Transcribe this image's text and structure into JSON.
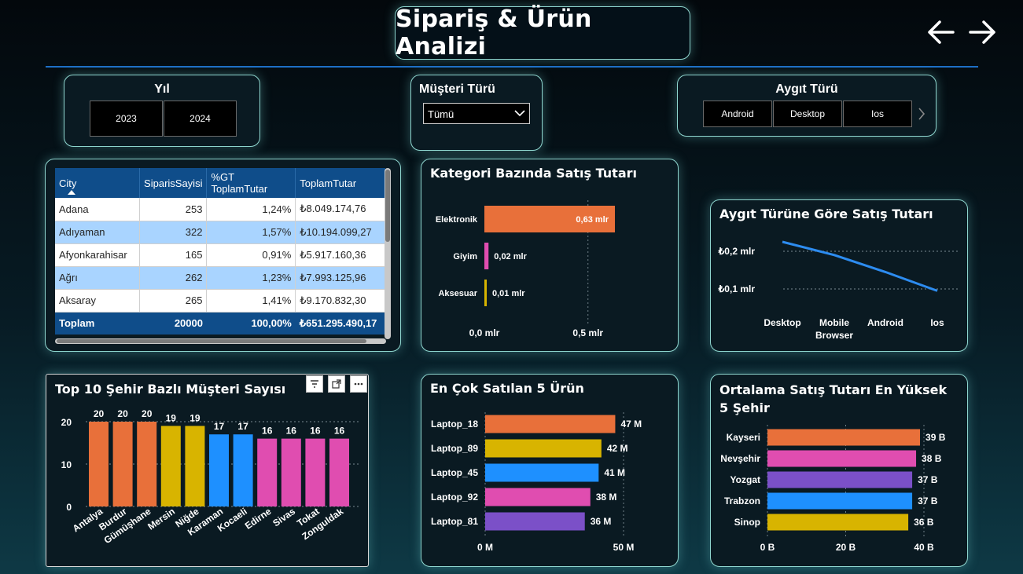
{
  "header": {
    "title": "Sipariş & Ürün Analizi",
    "back_icon": "arrow-left-icon",
    "forward_icon": "arrow-right-icon"
  },
  "slicer_year": {
    "title": "Yıl",
    "options": [
      "2023",
      "2024"
    ]
  },
  "slicer_customer": {
    "title": "Müşteri Türü",
    "selected": "Tümü"
  },
  "slicer_device": {
    "title": "Aygıt Türü",
    "options": [
      "Android",
      "Desktop",
      "Ios"
    ]
  },
  "city_table": {
    "headers": [
      "City",
      "SiparisSayisi",
      "%GT ToplamTutar",
      "ToplamTutar"
    ],
    "rows": [
      [
        "Adana",
        "253",
        "1,24%",
        "₺8.049.174,76"
      ],
      [
        "Adıyaman",
        "322",
        "1,57%",
        "₺10.194.099,27"
      ],
      [
        "Afyonkarahisar",
        "165",
        "0,91%",
        "₺5.917.160,36"
      ],
      [
        "Ağrı",
        "262",
        "1,23%",
        "₺7.993.125,96"
      ],
      [
        "Aksaray",
        "265",
        "1,41%",
        "₺9.170.832,30"
      ]
    ],
    "total": [
      "Toplam",
      "20000",
      "100,00%",
      "₺651.295.490,17"
    ]
  },
  "chart_data": [
    {
      "id": "category",
      "type": "bar",
      "orientation": "horizontal",
      "title": "Kategori Bazında Satış Tutarı",
      "categories": [
        "Elektronik",
        "Giyim",
        "Aksesuar"
      ],
      "values": [
        0.63,
        0.02,
        0.01
      ],
      "data_labels": [
        "0,63 mlr",
        "0,02 mlr",
        "0,01 mlr"
      ],
      "colors": [
        "#e8703a",
        "#e04db0",
        "#d8b400"
      ],
      "x_ticks": [
        "0,0 mlr",
        "0,5 mlr"
      ],
      "xlim": [
        0,
        0.63
      ]
    },
    {
      "id": "device",
      "type": "line",
      "title": "Aygıt Türüne Göre Satış Tutarı",
      "categories": [
        "Desktop",
        "Mobile Browser",
        "Android",
        "Ios"
      ],
      "values": [
        0.225,
        0.19,
        0.145,
        0.095
      ],
      "y_ticks": [
        "₺0,2 mlr",
        "₺0,1 mlr"
      ],
      "ylim": [
        0.1,
        0.2
      ],
      "color": "#2d8cf0"
    },
    {
      "id": "top10",
      "type": "bar",
      "title": "Top 10 Şehir Bazlı Müşteri Sayısı",
      "categories": [
        "Antalya",
        "Burdur",
        "Gümüşhane",
        "Mersin",
        "Niğde",
        "Karaman",
        "Kocaeli",
        "Edirne",
        "Sivas",
        "Tokat",
        "Zonguldak"
      ],
      "values": [
        20,
        20,
        20,
        19,
        19,
        17,
        17,
        16,
        16,
        16,
        16
      ],
      "colors": [
        "#e8703a",
        "#e8703a",
        "#e8703a",
        "#d8b400",
        "#d8b400",
        "#1e90ff",
        "#1e90ff",
        "#e04db0",
        "#e04db0",
        "#e04db0",
        "#e04db0"
      ],
      "y_ticks": [
        "20",
        "10",
        "0"
      ],
      "ylim": [
        0,
        20
      ]
    },
    {
      "id": "top5products",
      "type": "bar",
      "orientation": "horizontal",
      "title": "En Çok Satılan 5 Ürün",
      "categories": [
        "Laptop_18",
        "Laptop_89",
        "Laptop_45",
        "Laptop_92",
        "Laptop_81"
      ],
      "values": [
        47,
        42,
        41,
        38,
        36
      ],
      "data_labels": [
        "47 M",
        "42 M",
        "41 M",
        "38 M",
        "36 M"
      ],
      "colors": [
        "#e8703a",
        "#d8b400",
        "#1e90ff",
        "#e04db0",
        "#7b50c8"
      ],
      "x_ticks": [
        "0 M",
        "50 M"
      ],
      "xlim": [
        0,
        50
      ]
    },
    {
      "id": "avgcity",
      "type": "bar",
      "orientation": "horizontal",
      "title": "Ortalama Satış Tutarı En Yüksek 5 Şehir",
      "categories": [
        "Kayseri",
        "Nevşehir",
        "Yozgat",
        "Trabzon",
        "Sinop"
      ],
      "values": [
        39,
        38,
        37,
        37,
        36
      ],
      "data_labels": [
        "39 B",
        "38 B",
        "37 B",
        "37 B",
        "36 B"
      ],
      "colors": [
        "#e8703a",
        "#e04db0",
        "#7b50c8",
        "#1e90ff",
        "#d8b400"
      ],
      "x_ticks": [
        "0 B",
        "20 B",
        "40 B"
      ],
      "xlim": [
        0,
        40
      ]
    }
  ]
}
